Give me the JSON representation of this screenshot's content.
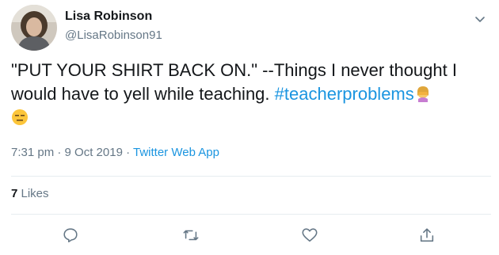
{
  "user": {
    "name": "Lisa Robinson",
    "handle": "@LisaRobinson91"
  },
  "tweet": {
    "text_main": "\"PUT YOUR SHIRT BACK ON.\" --Things I never thought I would have to yell while teaching. ",
    "hashtag": "#teacherproblems",
    "emojis": [
      "woman-facepalming-emoji",
      "expressionless-face-emoji"
    ]
  },
  "meta": {
    "time": "7:31 pm",
    "separator": " · ",
    "date": "9 Oct 2019",
    "separator2": " · ",
    "source": "Twitter Web App"
  },
  "likes": {
    "count": "7",
    "label": " Likes"
  },
  "actions": [
    "reply-icon",
    "retweet-icon",
    "like-icon",
    "share-icon"
  ],
  "colors": {
    "text": "#14171a",
    "secondary": "#657786",
    "link": "#1b95e0",
    "divider": "#e6ecf0"
  }
}
